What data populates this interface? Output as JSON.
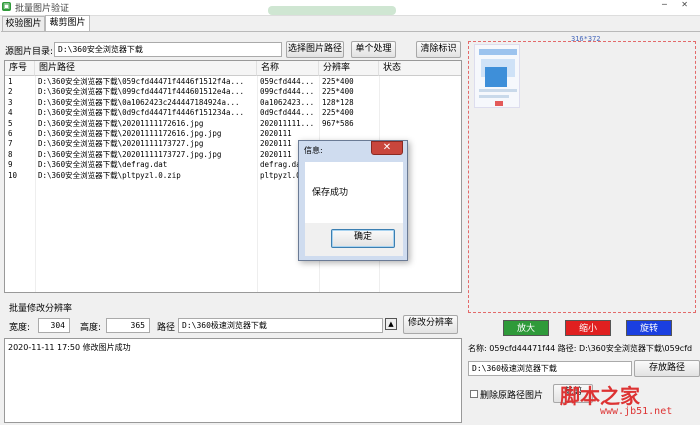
{
  "window": {
    "title": "批量图片验证",
    "controls": "─ ✕"
  },
  "tabs": [
    {
      "label": "校验图片"
    },
    {
      "label": "裁剪图片"
    }
  ],
  "toolbar": {
    "source_label": "源图片目录:",
    "source_value": "D:\\360安全浏览器下载",
    "select_path_label": "选择图片路径",
    "single_label": "单个处理",
    "clear_label": "清除标识"
  },
  "table": {
    "headers": [
      "序号",
      "图片路径",
      "名称",
      "分辨率",
      "状态"
    ],
    "rows": [
      [
        "1",
        "D:\\360安全浏览器下载\\059cfd44471f4446f1512f4a...",
        "059cfd444...",
        "225*400",
        ""
      ],
      [
        "2",
        "D:\\360安全浏览器下载\\099cfd44471f444601512e4a...",
        "099cfd444...",
        "225*400",
        ""
      ],
      [
        "3",
        "D:\\360安全浏览器下载\\0a1062423c244447184924a...",
        "0a1062423...",
        "128*128",
        ""
      ],
      [
        "4",
        "D:\\360安全浏览器下载\\0d9cfd44471f4446f151234a...",
        "0d9cfd444...",
        "225*400",
        ""
      ],
      [
        "5",
        "D:\\360安全浏览器下载\\20201111172616.jpg",
        "202011111...",
        "967*586",
        ""
      ],
      [
        "6",
        "D:\\360安全浏览器下载\\20201111172616.jpg.jpg",
        "2020111",
        "",
        ""
      ],
      [
        "7",
        "D:\\360安全浏览器下载\\20201111173727.jpg",
        "2020111",
        "",
        ""
      ],
      [
        "8",
        "D:\\360安全浏览器下载\\20201111173727.jpg.jpg",
        "2020111",
        "",
        ""
      ],
      [
        "9",
        "D:\\360安全浏览器下载\\defrag.dat",
        "defrag.da",
        "",
        ""
      ],
      [
        "10",
        "D:\\360安全浏览器下载\\pltpyzl.0.zip",
        "pltpyzl.0",
        "",
        ""
      ]
    ]
  },
  "batch": {
    "title": "批量修改分辨率",
    "width_label": "宽度:",
    "width_value": "304",
    "height_label": "高度:",
    "height_value": "365",
    "path_label": "路径",
    "path_value": "D:\\360极速浏览器下载",
    "up_icon": "▲",
    "modify_label": "修改分辨率"
  },
  "log": {
    "text": "2020-11-11 17:50 修改图片成功"
  },
  "preview": {
    "size": "316*372"
  },
  "controls": {
    "zoom_in": "放大",
    "zoom_out": "缩小",
    "rotate": "旋转"
  },
  "output": {
    "name_label": "名称: 059cfd44471f44  路径: D:\\360安全浏览器下载\\059cfd",
    "save_path_value": "D:\\360极速浏览器下载",
    "save_path_label": "存放路径",
    "delete_label": "删除原路径图片",
    "crop_label": "裁剪"
  },
  "dialog": {
    "title": "信息:",
    "message": "保存成功",
    "ok_label": "确定",
    "close": "✕"
  },
  "watermark": {
    "text": "脚本之家",
    "url": "www.jb51.net"
  },
  "colors": {
    "zoom_in": "#2f9a3a",
    "zoom_out": "#e02020",
    "rotate": "#1a3fe0",
    "accent_border": "#e36a6a"
  }
}
